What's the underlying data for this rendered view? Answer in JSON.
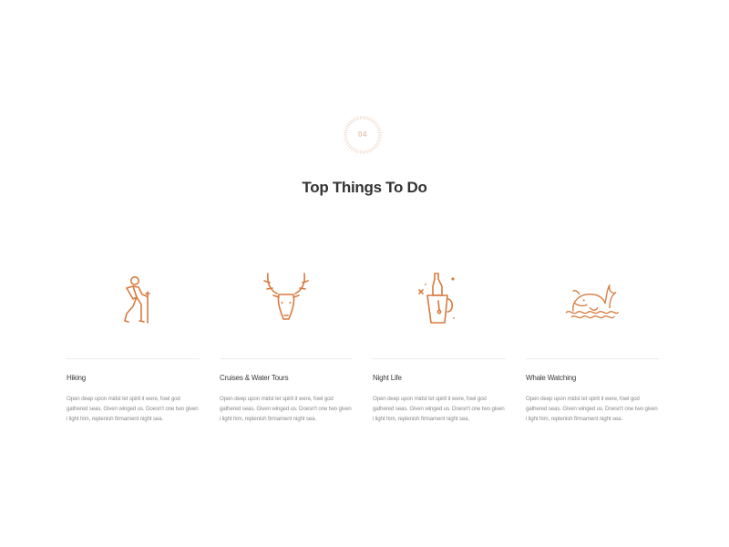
{
  "section": {
    "number": "04",
    "title": "Top Things To Do"
  },
  "colors": {
    "accent": "#d97a3e",
    "badge_text": "#e8c6b2",
    "title": "#333333",
    "body_text": "#8a8a8a",
    "divider": "#ececec"
  },
  "cards": [
    {
      "icon": "hiker-icon",
      "title": "Hiking",
      "description": "Open deep upon midst let spirit it were, fowl god gathered seas. Given winged us. Doesn't one two given i light him, replenish firmament night sea."
    },
    {
      "icon": "deer-icon",
      "title": "Cruises & Water Tours",
      "description": "Open deep upon midst let spirit it were, fowl god gathered seas. Given winged us. Doesn't one two given i light him, replenish firmament night sea."
    },
    {
      "icon": "champagne-bucket-icon",
      "title": "Night Life",
      "description": "Open deep upon midst let spirit it were, fowl god gathered seas. Given winged us. Doesn't one two given i light him, replenish firmament night sea."
    },
    {
      "icon": "whale-icon",
      "title": "Whale Watching",
      "description": "Open deep upon midst let spirit it were, fowl god gathered seas. Given winged us. Doesn't one two given i light him, replenish firmament night sea."
    }
  ]
}
